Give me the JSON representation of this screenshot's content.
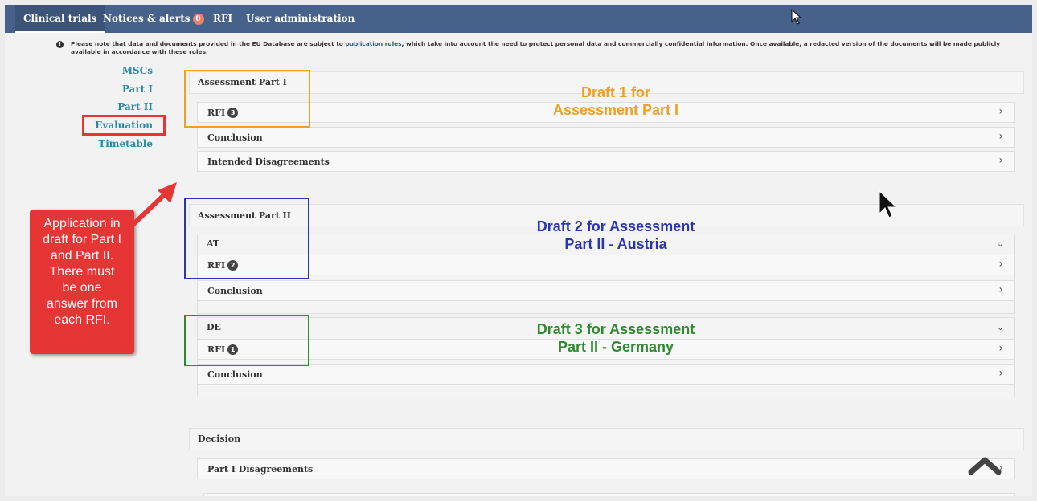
{
  "topnav": {
    "tabs": [
      {
        "label": "Clinical trials"
      },
      {
        "label": "Notices & alerts",
        "badge": "0"
      },
      {
        "label": "RFI"
      },
      {
        "label": "User administration"
      }
    ]
  },
  "notice": {
    "before_link": "Please note that data and documents provided in the EU Database are subject to ",
    "link": "publication rules",
    "after_link": ", which take into account the need to protect personal data and commercially confidential information. Once available, a redacted version of the documents will be made publicly available in accordance with these rules."
  },
  "leftnav": {
    "items": [
      "MSCs",
      "Part I",
      "Part II",
      "Evaluation",
      "Timetable"
    ]
  },
  "part1": {
    "title": "Assessment Part I",
    "rfi_label": "RFI",
    "rfi_count": "3",
    "conclusion": "Conclusion",
    "disagreements": "Intended Disagreements"
  },
  "part2": {
    "title": "Assessment Part II",
    "at": {
      "country": "AT",
      "rfi_label": "RFI",
      "rfi_count": "2",
      "conclusion": "Conclusion"
    },
    "de": {
      "country": "DE",
      "rfi_label": "RFI",
      "rfi_count": "1",
      "conclusion": "Conclusion"
    }
  },
  "decision": {
    "title": "Decision",
    "part1_disagreements": "Part I Disagreements"
  },
  "annotations": {
    "draft1": [
      "Draft 1 for",
      "Assessment Part I"
    ],
    "draft2": [
      "Draft 2 for Assessment",
      "Part II - Austria"
    ],
    "draft3": [
      "Draft 3 for Assessment",
      "Part II - Germany"
    ],
    "callout": [
      "Application in",
      "draft for Part I",
      "and Part II.",
      "There must",
      "be one",
      "answer from",
      "each RFI."
    ],
    "colors": {
      "draft1": "#f0a020",
      "draft2": "#2a35b0",
      "draft3": "#2e8a2e",
      "callout": "#e53535",
      "highlight": "#e53535"
    }
  }
}
